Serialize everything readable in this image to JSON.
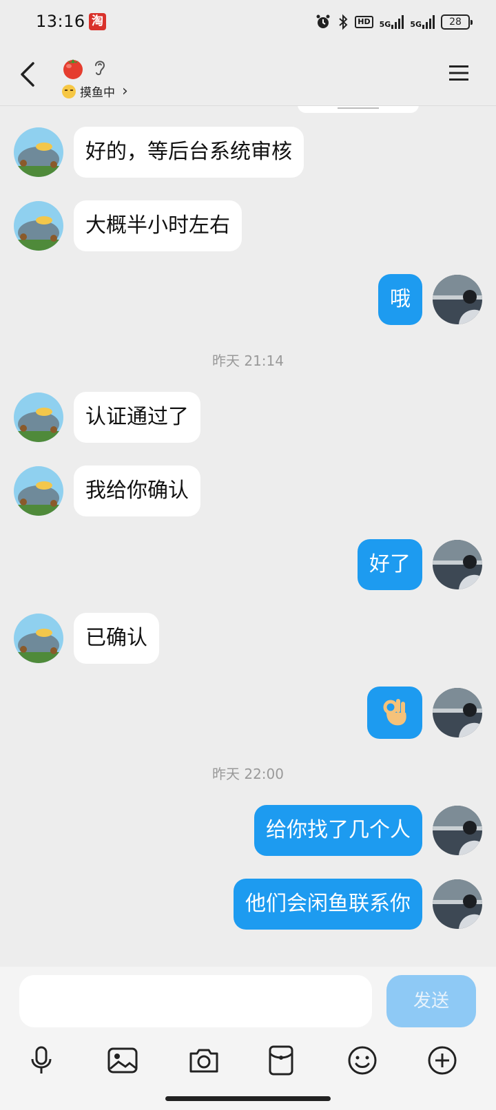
{
  "status_bar": {
    "time": "13:16",
    "app_badge": "淘",
    "hd_label": "HD",
    "network_1": "5G",
    "network_2": "5G",
    "battery": "28"
  },
  "header": {
    "contact_emoji": "tomato",
    "status_text": "摸鱼中",
    "status_chevron": "›"
  },
  "messages": [
    {
      "side": "left",
      "text": "好的，等后台系统审核"
    },
    {
      "side": "left",
      "text": "大概半小时左右"
    },
    {
      "side": "right",
      "text": "哦"
    },
    {
      "side": "time",
      "text": "昨天 21:14"
    },
    {
      "side": "left",
      "text": "认证通过了"
    },
    {
      "side": "left",
      "text": "我给你确认"
    },
    {
      "side": "right",
      "text": "好了"
    },
    {
      "side": "left",
      "text": "已确认"
    },
    {
      "side": "right",
      "text": "",
      "emoji": "ok-hand"
    },
    {
      "side": "time",
      "text": "昨天 22:00"
    },
    {
      "side": "right",
      "text": "给你找了几个人"
    },
    {
      "side": "right",
      "text": "他们会闲鱼联系你"
    }
  ],
  "input": {
    "placeholder": "",
    "send_label": "发送"
  },
  "colors": {
    "background": "#ededed",
    "outgoing_bubble": "#1d9bf0",
    "incoming_bubble": "#ffffff",
    "send_button_disabled": "#8ec9f5"
  }
}
